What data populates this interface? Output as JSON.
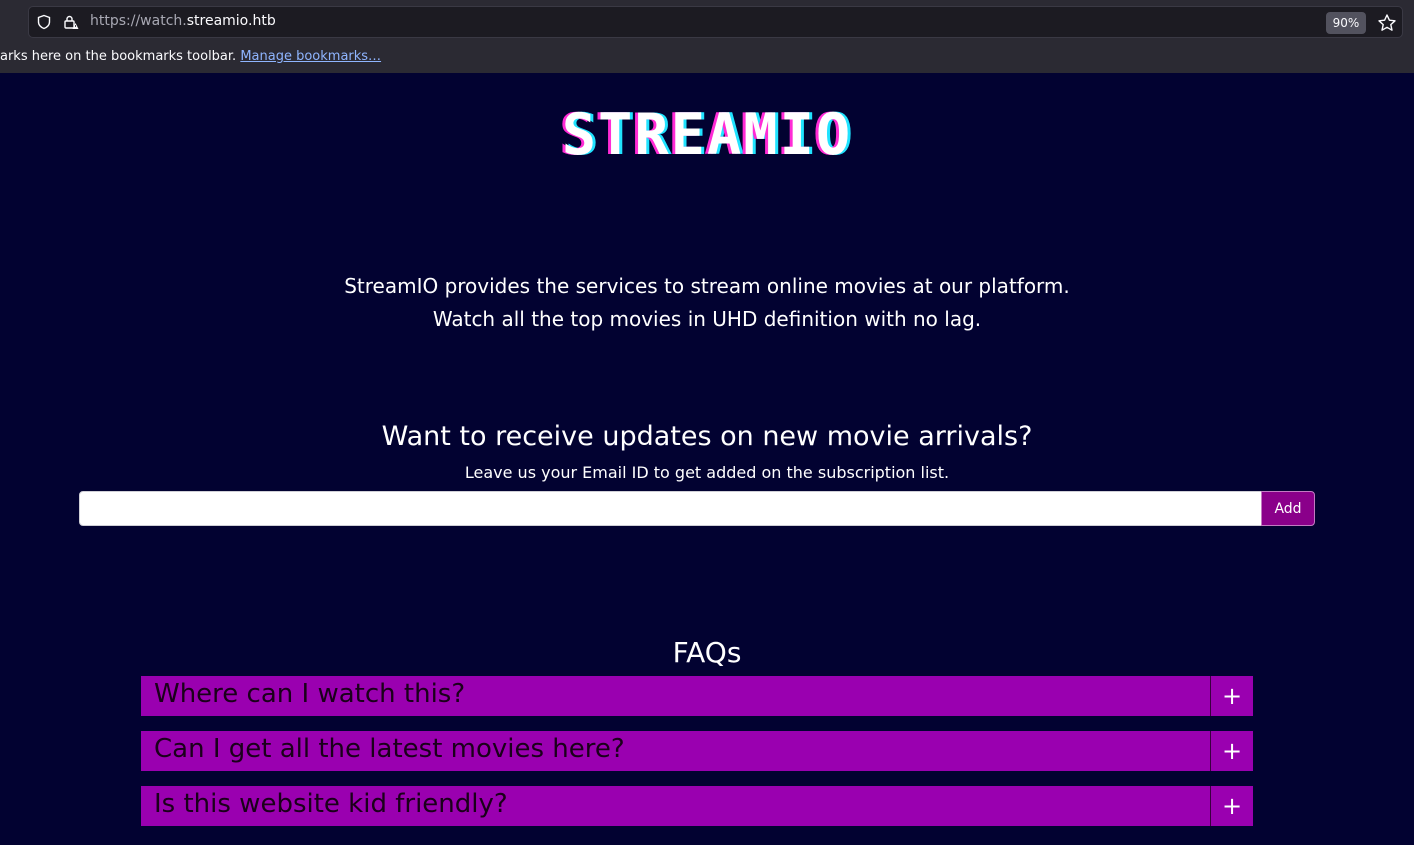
{
  "browser": {
    "url_prefix": "https://watch.",
    "url_host": "streamio.htb",
    "zoom": "90%",
    "bookmarks_text": "arks here on the bookmarks toolbar.",
    "manage_bookmarks": "Manage bookmarks…"
  },
  "page": {
    "logo": "STREAMIO",
    "intro_line1": "StreamIO provides the services to stream online movies at our platform.",
    "intro_line2": "Watch all the top movies in UHD definition with no lag.",
    "subscribe": {
      "heading": "Want to receive updates on new movie arrivals?",
      "subtext": "Leave us your Email ID to get added on the subscription list.",
      "email_value": "",
      "add_label": "Add"
    },
    "faq": {
      "title": "FAQs",
      "items": [
        {
          "question": "Where can I watch this?",
          "toggle": "+"
        },
        {
          "question": "Can I get all the latest movies here?",
          "toggle": "+"
        },
        {
          "question": "Is this website kid friendly?",
          "toggle": "+"
        }
      ]
    }
  },
  "colors": {
    "background": "#020231",
    "faq_bar": "#9a00b0",
    "add_button": "#8a008a",
    "logo_left_shadow": "#ff2bd6",
    "logo_right_shadow": "#20e3ff"
  },
  "icons": [
    "shield-icon",
    "lock-warning-icon",
    "star-icon"
  ]
}
